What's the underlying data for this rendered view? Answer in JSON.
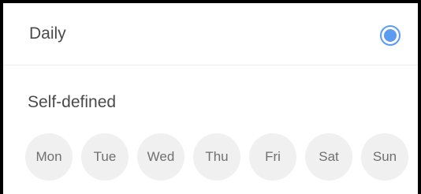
{
  "daily_option": {
    "label": "Daily",
    "selected": true
  },
  "self_defined": {
    "title": "Self-defined",
    "days": [
      "Mon",
      "Tue",
      "Wed",
      "Thu",
      "Fri",
      "Sat",
      "Sun"
    ]
  },
  "colors": {
    "accent": "#5b9bf0",
    "day_chip_bg": "#f0f0f0",
    "text": "#4a4a4a",
    "frame": "#000000"
  }
}
